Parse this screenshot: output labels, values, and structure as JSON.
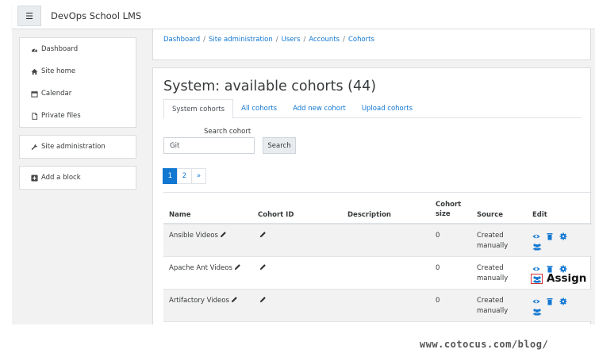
{
  "app": {
    "title": "DevOps School LMS"
  },
  "nav": {
    "items": [
      {
        "label": "Dashboard",
        "icon": "dashboard-icon"
      },
      {
        "label": "Site home",
        "icon": "home-icon"
      },
      {
        "label": "Calendar",
        "icon": "calendar-icon"
      },
      {
        "label": "Private files",
        "icon": "file-icon"
      }
    ],
    "site_admin": {
      "label": "Site administration",
      "icon": "wrench-icon"
    },
    "add_block": {
      "label": "Add a block",
      "icon": "plus-square-icon"
    }
  },
  "breadcrumb": [
    "Dashboard",
    "Site administration",
    "Users",
    "Accounts",
    "Cohorts"
  ],
  "page": {
    "title": "System: available cohorts (44)"
  },
  "tabs": [
    "System cohorts",
    "All cohorts",
    "Add new cohort",
    "Upload cohorts"
  ],
  "search": {
    "label": "Search cohort",
    "value": "Git",
    "button": "Search"
  },
  "pagination": [
    "1",
    "2",
    "»"
  ],
  "table": {
    "headers": {
      "name": "Name",
      "cohort_id": "Cohort ID",
      "description": "Description",
      "cohort_size_1": "Cohort",
      "cohort_size_2": "size",
      "source": "Source",
      "edit": "Edit"
    },
    "rows": [
      {
        "name": "Ansible Videos",
        "size": "0",
        "source_1": "Created",
        "source_2": "manually"
      },
      {
        "name": "Apache Ant Videos",
        "size": "0",
        "source_1": "Created",
        "source_2": "manually"
      },
      {
        "name": "Artifactory Videos",
        "size": "0",
        "source_1": "Created",
        "source_2": "manually"
      }
    ]
  },
  "annotation": {
    "label": "Assign"
  },
  "watermark": "www.cotocus.com/blog/",
  "colors": {
    "link": "#1177d1",
    "highlight": "#d32f2f"
  }
}
